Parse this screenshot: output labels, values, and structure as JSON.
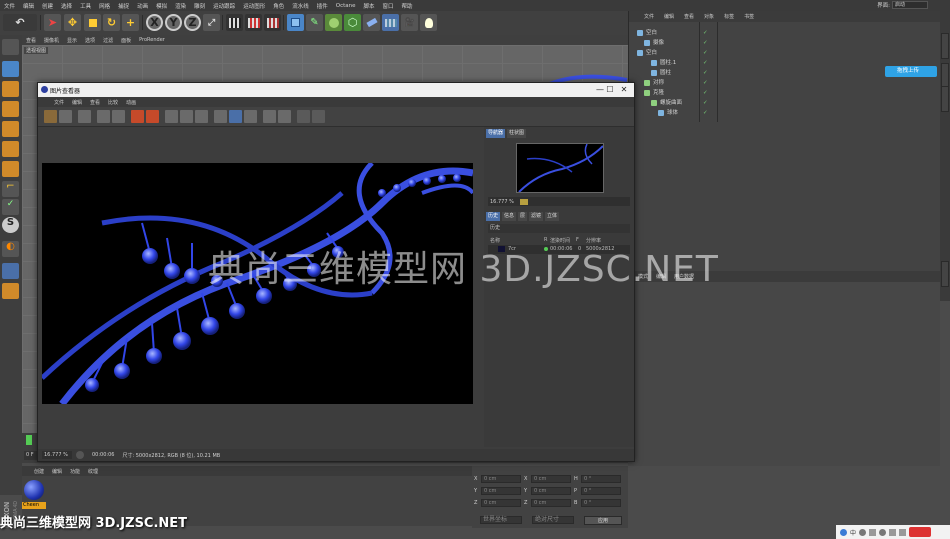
{
  "menubar": {
    "items": [
      "文件",
      "编辑",
      "创建",
      "选择",
      "工具",
      "网格",
      "捕捉",
      "动画",
      "模拟",
      "渲染",
      "雕刻",
      "运动跟踪",
      "运动图形",
      "角色",
      "流水线",
      "插件",
      "Octane",
      "脚本",
      "窗口",
      "帮助"
    ],
    "layout_label": "界面:",
    "layout_value": "启动"
  },
  "toolbar": {
    "undo_icon": "undo-icon",
    "axis_labels": [
      "X",
      "Y",
      "Z"
    ]
  },
  "viewport": {
    "menu": [
      "查看",
      "摄像机",
      "显示",
      "选项",
      "过滤",
      "面板",
      "ProRender"
    ],
    "view_label": "透视视图"
  },
  "picture_viewer": {
    "title": "图片查看器",
    "menu": [
      "文件",
      "编辑",
      "查看",
      "比较",
      "动画"
    ],
    "right_tabs": [
      "导航器",
      "柱状图"
    ],
    "zoom": "16.777 %",
    "history_tabs": [
      "历史",
      "信息",
      "层",
      "滤镜",
      "立体"
    ],
    "history_label": "历史",
    "history_headers": [
      "名称",
      "R",
      "渲染时间",
      "F",
      "分辨率"
    ],
    "history_row": {
      "name": "7cr",
      "time": "00:00:06",
      "f": "0",
      "res": "5000x2812"
    },
    "status_zoom": "16.777 %",
    "status_time": "00:00:06",
    "status_info": "尺寸: 5000x2812, RGB (8 位), 10.21 MB"
  },
  "object_manager": {
    "menu": [
      "文件",
      "编辑",
      "查看",
      "对象",
      "标签",
      "书签"
    ],
    "rows": [
      {
        "name": "空白",
        "indent": 0,
        "color": "#7fb5e0"
      },
      {
        "name": "摄像",
        "indent": 1,
        "color": "#7fb5e0"
      },
      {
        "name": "空白",
        "indent": 0,
        "color": "#7fb5e0"
      },
      {
        "name": "圆柱.1",
        "indent": 2,
        "color": "#7fb5e0"
      },
      {
        "name": "圆柱",
        "indent": 2,
        "color": "#7fb5e0"
      },
      {
        "name": "对称",
        "indent": 1,
        "color": "#8fd07f"
      },
      {
        "name": "克隆",
        "indent": 1,
        "color": "#8fd07f"
      },
      {
        "name": "螺旋曲面",
        "indent": 2,
        "color": "#8fd07f"
      },
      {
        "name": "球体",
        "indent": 3,
        "color": "#7fb5e0"
      }
    ],
    "upload_label": "拖拽上传"
  },
  "attribute_manager": {
    "menu": [
      "模式",
      "编辑",
      "用户数据"
    ]
  },
  "material_manager": {
    "menu": [
      "创建",
      "编辑",
      "功能",
      "纹理"
    ],
    "material_name": "Cheen"
  },
  "coordinates": {
    "rows": [
      {
        "a": "X",
        "av": "0 cm",
        "b": "X",
        "bv": "0 cm",
        "c": "H",
        "cv": "0 °"
      },
      {
        "a": "Y",
        "av": "0 cm",
        "b": "Y",
        "bv": "0 cm",
        "c": "P",
        "cv": "0 °"
      },
      {
        "a": "Z",
        "av": "0 cm",
        "b": "Z",
        "bv": "0 cm",
        "c": "B",
        "cv": "0 °"
      }
    ],
    "mode1": "世界坐标",
    "mode2": "绝对尺寸",
    "apply": "应用"
  },
  "timeline": {
    "frame": "0 F"
  },
  "watermark": {
    "big": "典尚三维模型网 3D.JZSC.NET",
    "small": "典尚三维模型网 3D.JZSC.NET"
  },
  "tray": {
    "ime": "中"
  },
  "colors": {
    "accent": "#4a6fa8",
    "helix": "#3a4fe0",
    "upload": "#2fa3e6"
  }
}
